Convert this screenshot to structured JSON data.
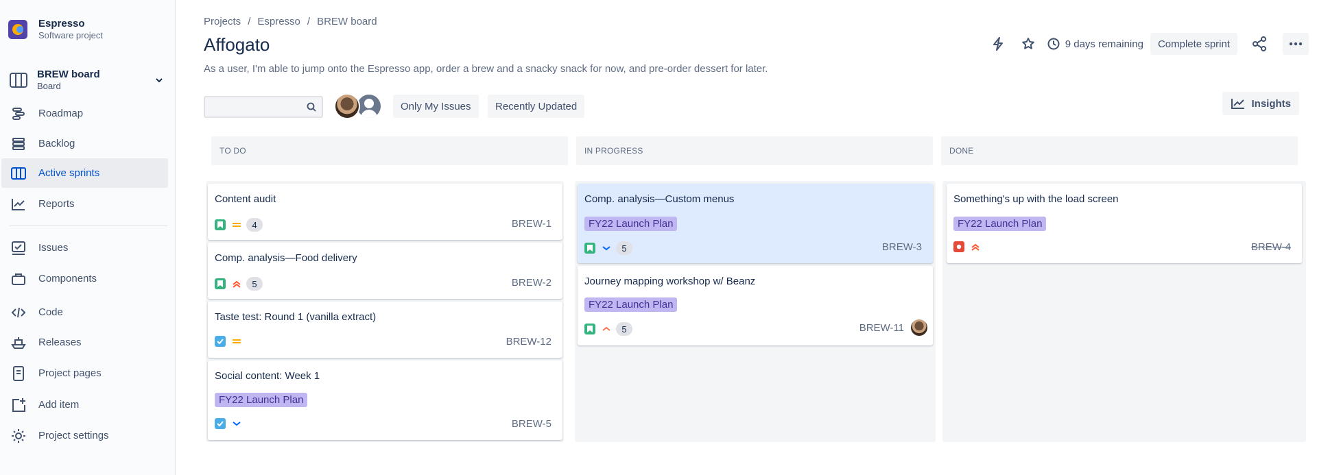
{
  "project": {
    "name": "Espresso",
    "type": "Software project"
  },
  "board": {
    "name": "BREW board",
    "subtitle": "Board"
  },
  "sidebar": {
    "items": [
      {
        "label": "Roadmap",
        "icon": "roadmap-icon"
      },
      {
        "label": "Backlog",
        "icon": "backlog-icon"
      },
      {
        "label": "Active sprints",
        "icon": "board-columns-icon",
        "active": true
      },
      {
        "label": "Reports",
        "icon": "reports-icon"
      },
      {
        "label": "Issues",
        "icon": "issues-icon"
      },
      {
        "label": "Components",
        "icon": "components-icon"
      },
      {
        "label": "Code",
        "icon": "code-icon"
      },
      {
        "label": "Releases",
        "icon": "releases-icon"
      },
      {
        "label": "Project pages",
        "icon": "page-icon"
      },
      {
        "label": "Add item",
        "icon": "add-item-icon"
      },
      {
        "label": "Project settings",
        "icon": "gear-icon"
      }
    ]
  },
  "breadcrumb": [
    "Projects",
    "Espresso",
    "BREW board"
  ],
  "sprint": {
    "title": "Affogato",
    "goal": "As a user, I'm able to jump onto the Espresso app, order a brew and a snacky snack for now, and pre-order dessert for later.",
    "days_remaining": "9 days remaining",
    "complete_label": "Complete sprint"
  },
  "filters": {
    "search_placeholder": "",
    "only_my_issues": "Only My Issues",
    "recently_updated": "Recently Updated",
    "insights": "Insights"
  },
  "columns": [
    {
      "title": "TO DO",
      "cards": [
        {
          "title": "Content audit",
          "type": "story",
          "priority": "medium",
          "points": "4",
          "key": "BREW-1"
        },
        {
          "title": "Comp. analysis—Food delivery",
          "type": "story",
          "priority": "high",
          "points": "5",
          "key": "BREW-2"
        },
        {
          "title": "Taste test: Round 1 (vanilla extract)",
          "type": "task",
          "priority": "medium",
          "key": "BREW-12"
        },
        {
          "title": "Social content: Week 1",
          "epic": "FY22 Launch Plan",
          "type": "task",
          "priority": "low",
          "key": "BREW-5"
        }
      ]
    },
    {
      "title": "IN PROGRESS",
      "cards": [
        {
          "title": "Comp. analysis—Custom menus",
          "epic": "FY22 Launch Plan",
          "type": "story",
          "priority": "low",
          "points": "5",
          "key": "BREW-3",
          "selected": true
        },
        {
          "title": "Journey mapping workshop w/ Beanz",
          "epic": "FY22 Launch Plan",
          "type": "story",
          "priority": "medium-high",
          "points": "5",
          "key": "BREW-11",
          "assignee": true
        }
      ]
    },
    {
      "title": "DONE",
      "cards": [
        {
          "title": "Something's up with the load screen",
          "epic": "FY22 Launch Plan",
          "type": "bug",
          "priority": "high",
          "key": "BREW-4",
          "done": true
        }
      ]
    }
  ],
  "colors": {
    "accent": "#0052cc",
    "story": "#36b37e",
    "task": "#4bade8",
    "bug": "#e5493a",
    "epic_bg": "#c0b6f2",
    "epic_text": "#403294"
  }
}
